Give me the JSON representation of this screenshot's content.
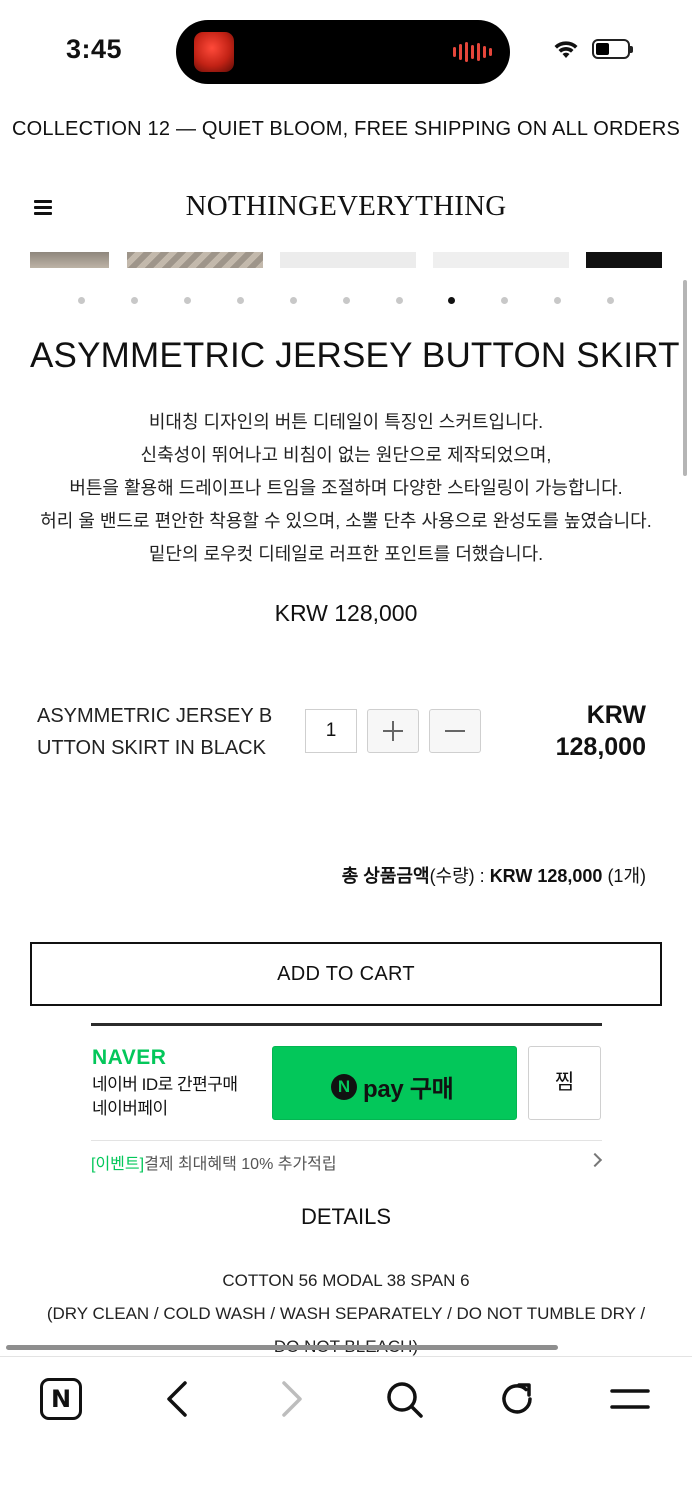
{
  "status_bar": {
    "time": "3:45"
  },
  "announcement": "COLLECTION 12 — QUIET BLOOM, FREE SHIPPING ON ALL ORDERS",
  "header": {
    "logo": "NOTHINGEVERYTHING"
  },
  "gallery": {
    "dots_total": 11,
    "active_dot_index": 7
  },
  "product": {
    "title": "ASYMMETRIC JERSEY BUTTON SKIRT I",
    "description": [
      "비대칭 디자인의 버튼 디테일이 특징인 스커트입니다.",
      "신축성이 뛰어나고 비침이 없는 원단으로 제작되었으며,",
      "버튼을 활용해 드레이프나 트임을 조절하며 다양한 스타일링이 가능합니다.",
      "허리 울 밴드로 편안한 착용할 수 있으며, 소뿔 단추 사용으로 완성도를 높였습니다.",
      "밑단의 로우컷 디테일로 러프한 포인트를 더했습니다."
    ],
    "price": "KRW 128,000"
  },
  "option": {
    "name": "ASYMMETRIC JERSEY BUTTON SKIRT IN BLACK",
    "quantity": "1",
    "price": "KRW 128,000"
  },
  "total": {
    "label": "총 상품금액",
    "qty_label": "(수량) : ",
    "amount": "KRW 128,000",
    "count": "(1개)"
  },
  "add_to_cart_label": "ADD TO CART",
  "naver_pay": {
    "brand": "NAVER",
    "sub_line1": "네이버 ID로 간편구매",
    "sub_line2": "네이버페이",
    "pay_label": "pay 구매",
    "zzim_label": "찜",
    "event_tag": "[이벤트]",
    "event_text": "결제 최대혜택 10% 추가적립"
  },
  "details": {
    "title": "DETAILS",
    "lines": [
      "COTTON 56 MODAL 38 SPAN 6",
      "(DRY CLEAN / COLD WASH / WASH SEPARATELY / DO NOT TUMBLE DRY /",
      "DO NOT BLEACH)"
    ]
  },
  "browser_bar": {
    "app_icon_letter": "N",
    "icons": [
      "naver-app-icon",
      "back-icon",
      "forward-icon",
      "search-icon",
      "reload-icon",
      "menu-icon"
    ]
  },
  "colors": {
    "naver_green": "#03c75a",
    "text": "#111111"
  }
}
